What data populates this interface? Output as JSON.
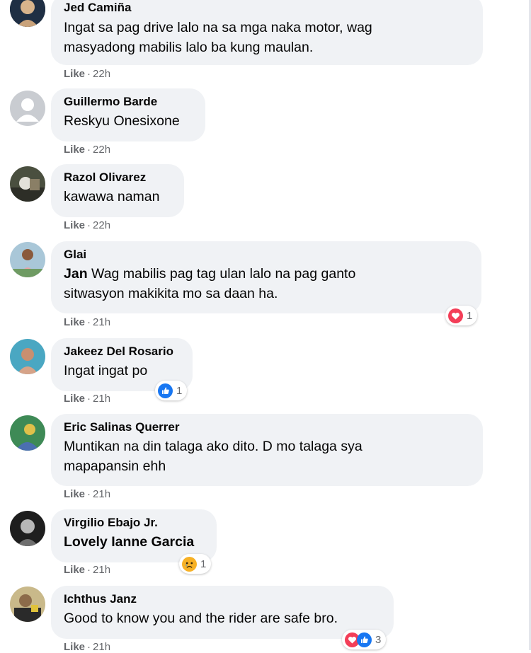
{
  "colors": {
    "bubble": "#f0f2f5",
    "meta": "#65676b",
    "love": "#f33e58",
    "like": "#1877f2",
    "sad": "#f7b125"
  },
  "comments": [
    {
      "author": "Jed Camiña",
      "text_lines": [
        "Ingat sa pag drive lalo na sa mga naka motor, wag",
        "masyadong mabilis lalo ba kung maulan."
      ],
      "like": "Like",
      "dot": "·",
      "time": "22h"
    },
    {
      "author": "Guillermo Barde",
      "text": "Reskyu Onesixone",
      "like": "Like",
      "dot": "·",
      "time": "22h"
    },
    {
      "author": "Razol Olivarez",
      "text": "kawawa naman",
      "like": "Like",
      "dot": "·",
      "time": "22h"
    },
    {
      "author": "Glai",
      "tag": "Jan",
      "text_first": " Wag mabilis pag tag ulan lalo na pag ganto",
      "text_second": "sitwasyon makikita mo sa daan ha.",
      "like": "Like",
      "dot": "·",
      "time": "21h",
      "reactions": {
        "icons": [
          "love-icon"
        ],
        "count": "1"
      }
    },
    {
      "author": "Jakeez Del Rosario",
      "text": "Ingat ingat po",
      "like": "Like",
      "dot": "·",
      "time": "21h",
      "reactions": {
        "icons": [
          "like-icon"
        ],
        "count": "1"
      }
    },
    {
      "author": "Eric Salinas Querrer",
      "text_lines": [
        "Muntikan na din talaga ako dito. D mo talaga sya",
        "mapapansin ehh"
      ],
      "like": "Like",
      "dot": "·",
      "time": "21h"
    },
    {
      "author": "Virgilio Ebajo Jr.",
      "tag": "Lovely Ianne Garcia",
      "like": "Like",
      "dot": "·",
      "time": "21h",
      "reactions": {
        "icons": [
          "sad-icon"
        ],
        "count": "1"
      }
    },
    {
      "author": "Ichthus Janz",
      "text": "Good to know you and the rider are safe bro.",
      "like": "Like",
      "dot": "·",
      "time": "21h",
      "reactions": {
        "icons": [
          "love-icon",
          "like-icon"
        ],
        "count": "3"
      }
    }
  ]
}
